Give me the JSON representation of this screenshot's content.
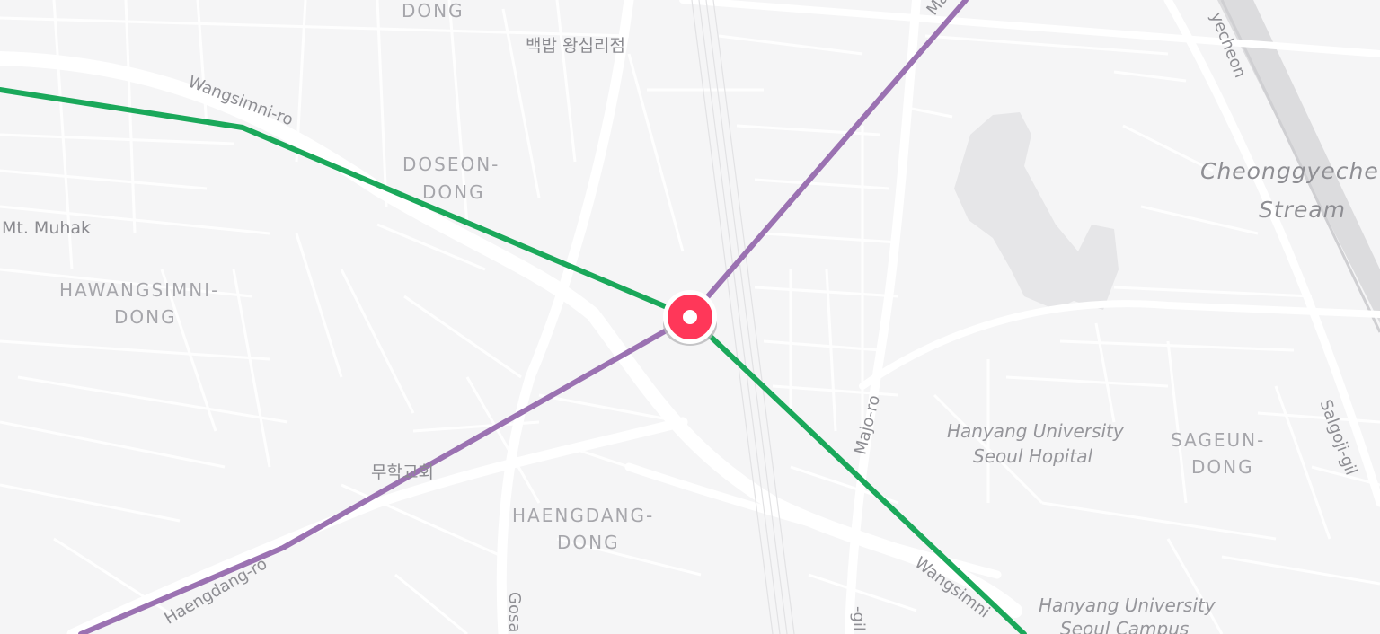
{
  "map": {
    "line_colors": {
      "green": "#1aa85a",
      "purple": "#9b72b2"
    },
    "marker": {
      "icon": "location-pin-icon",
      "color": "#ff3759"
    },
    "districts": {
      "dong_top": "DONG",
      "doseon_1": "DOSEON-",
      "doseon_2": "DONG",
      "hawangsimni_1": "HAWANGSIMNI-",
      "hawangsimni_2": "DONG",
      "haengdang_1": "HAENGDANG-",
      "haengdang_2": "DONG",
      "sageun_1": "SAGEUN-",
      "sageun_2": "DONG"
    },
    "roads": {
      "wangsimni_ro_nw": "Wangsimni-ro",
      "wangsimni_ro_se": "Wangsimni",
      "haengdang_ro": "Haengdang-ro",
      "majo_ro": "Majo-ro",
      "majo_ro_top": "Ma",
      "gosa": "Gosa",
      "gil_bottom": "-gil",
      "salgoji_gil": "Salgoji-gil",
      "yecheon": "yecheon"
    },
    "pois": {
      "restaurant": "백밥 왕십리점",
      "church": "무학교회",
      "mt_muhak": "Mt. Muhak"
    },
    "places": {
      "hospital_1": "Hanyang University",
      "hospital_2": "Seoul Hopital",
      "campus_1": "Hanyang University",
      "campus_2": "Seoul Campus"
    },
    "water": {
      "stream_1": "Cheonggyeche",
      "stream_2": "Stream"
    }
  }
}
